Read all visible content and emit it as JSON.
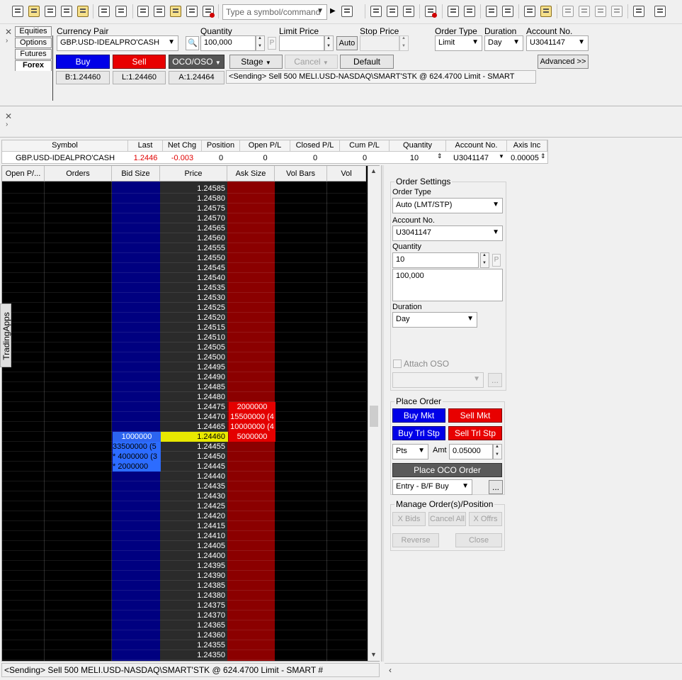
{
  "toolbar": {
    "symbol_placeholder": "Type a symbol/command",
    "icons_left": [
      "new-icon",
      "open-icon",
      "copy-icon",
      "new-folder-icon",
      "folder-icon",
      "print-preview-icon",
      "print-icon",
      "layout-icon",
      "columns-icon",
      "lock-icon",
      "tools-icon",
      "colors-icon"
    ],
    "icons_right": [
      "chart-icon",
      "report-icon",
      "account-icon",
      "settings-icon",
      "clock-icon",
      "list-icon",
      "window-icon",
      "tile-icon",
      "layout2-icon",
      "lock2-icon",
      "zoom-in-icon",
      "zoom-out-icon",
      "zoom-fit-icon",
      "zoom-reset-icon",
      "bars-icon",
      "monitor-icon"
    ]
  },
  "order_entry": {
    "asset_tabs": [
      "Equities",
      "Options",
      "Futures",
      "Forex"
    ],
    "currency_pair_label": "Currency Pair",
    "currency_pair_value": "GBP.USD-IDEALPRO'CASH",
    "quantity_label": "Quantity",
    "quantity_value": "100,000",
    "quantity_p": "P",
    "limit_price_label": "Limit Price",
    "limit_price_value": "",
    "auto_label": "Auto",
    "stop_price_label": "Stop Price",
    "stop_price_value": "",
    "order_type_label": "Order Type",
    "order_type_value": "Limit",
    "duration_label": "Duration",
    "duration_value": "Day",
    "account_label": "Account No.",
    "account_value": "U3041147",
    "buy_label": "Buy",
    "sell_label": "Sell",
    "oco_label": "OCO/OSO",
    "stage_label": "Stage",
    "cancel_label": "Cancel",
    "default_label": "Default",
    "advanced_label": "Advanced >>",
    "bid_quote": "B:1.24460",
    "last_quote": "L:1.24460",
    "ask_quote": "A:1.24464",
    "status": "<Sending> Sell 500 MELI.USD-NASDAQ\\SMART'STK @ 624.4700 Limit - SMART"
  },
  "quote_table": {
    "headers": [
      "Symbol",
      "Last",
      "Net Chg",
      "Position",
      "Open P/L",
      "Closed P/L",
      "Cum P/L",
      "Quantity",
      "Account No.",
      "Axis Inc"
    ],
    "row": [
      "GBP.USD-IDEALPRO'CASH",
      "1.2446",
      "-0.003",
      "0",
      "0",
      "0",
      "0",
      "10",
      "U3041147",
      "0.00005"
    ]
  },
  "ladder": {
    "headers": [
      "Open P/...",
      "Orders",
      "Bid Size",
      "Price",
      "Ask Size",
      "Vol Bars",
      "Vol"
    ],
    "prices": [
      "1.24585",
      "1.24580",
      "1.24575",
      "1.24570",
      "1.24565",
      "1.24560",
      "1.24555",
      "1.24550",
      "1.24545",
      "1.24540",
      "1.24535",
      "1.24530",
      "1.24525",
      "1.24520",
      "1.24515",
      "1.24510",
      "1.24505",
      "1.24500",
      "1.24495",
      "1.24490",
      "1.24485",
      "1.24480",
      "1.24475",
      "1.24470",
      "1.24465",
      "1.24460",
      "1.24455",
      "1.24450",
      "1.24445",
      "1.24440",
      "1.24435",
      "1.24430",
      "1.24425",
      "1.24420",
      "1.24415",
      "1.24410",
      "1.24405",
      "1.24400",
      "1.24395",
      "1.24390",
      "1.24385",
      "1.24380",
      "1.24375",
      "1.24370",
      "1.24365",
      "1.24360",
      "1.24355",
      "1.24350"
    ],
    "current_price": "1.24460",
    "asks": [
      {
        "price": "1.24475",
        "size": "2000000"
      },
      {
        "price": "1.24470",
        "size": "15500000  (4"
      },
      {
        "price": "1.24465",
        "size": "10000000  (4"
      },
      {
        "price": "1.24460",
        "size": "5000000"
      }
    ],
    "bids": [
      {
        "price": "1.24460",
        "size": "1000000"
      },
      {
        "price": "1.24455",
        "size": "33500000  (5"
      },
      {
        "price": "1.24450",
        "size": "* 4000000  (3"
      },
      {
        "price": "1.24445",
        "size": "* 2000000"
      }
    ]
  },
  "side_tab": "TradingApps",
  "settings": {
    "order_settings_title": "Order Settings",
    "order_type_label": "Order Type",
    "order_type_value": "Auto (LMT/STP)",
    "account_label": "Account No.",
    "account_value": "U3041147",
    "quantity_label": "Quantity",
    "quantity_value": "10",
    "quantity_p": "P",
    "quantity_text": "100,000",
    "duration_label": "Duration",
    "duration_value": "Day",
    "attach_oso_label": "Attach OSO",
    "ellipsis": "...",
    "place_order_title": "Place Order",
    "buy_mkt": "Buy Mkt",
    "sell_mkt": "Sell Mkt",
    "buy_trl": "Buy Trl Stp",
    "sell_trl": "Sell Trl Stp",
    "pts_value": "Pts",
    "amt_label": "Amt",
    "amt_value": "0.05000",
    "place_oco": "Place OCO Order",
    "entry_value": "Entry - B/F Buy",
    "manage_title": "Manage Order(s)/Position",
    "x_bids": "X Bids",
    "cancel_all": "Cancel All",
    "x_offrs": "X Offrs",
    "reverse": "Reverse",
    "close": "Close"
  },
  "statusbar": "<Sending> Sell 500 MELI.USD-NASDAQ\\SMART'STK @ 624.4700 Limit - SMART #",
  "colors": {
    "bid": "#2c6cff",
    "ask": "#e40000",
    "current": "#e8e800",
    "buy": "#0000e8",
    "sell": "#e80000"
  }
}
